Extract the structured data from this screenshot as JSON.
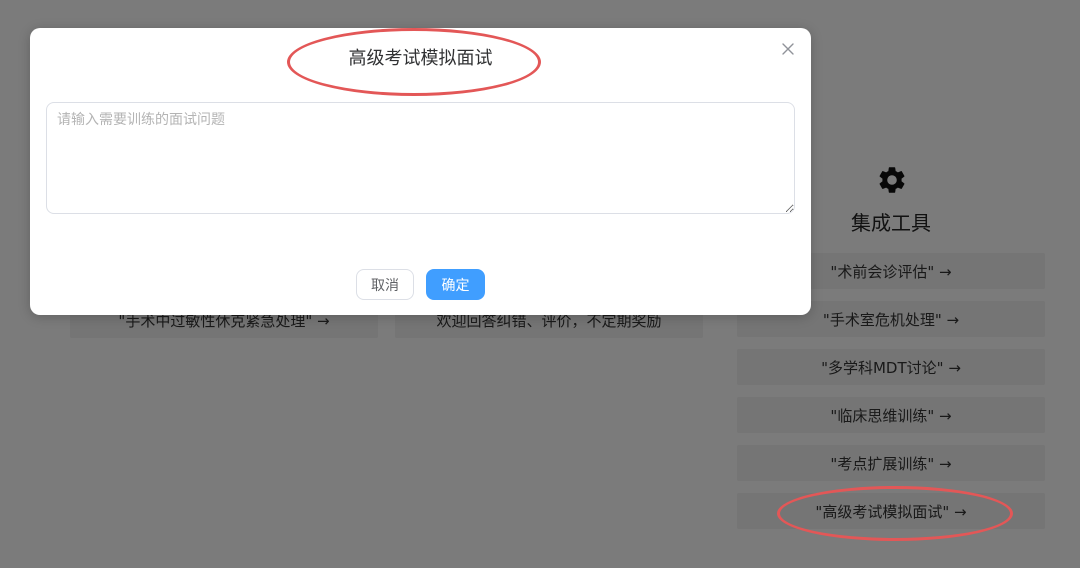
{
  "background": {
    "tools_title": "集成工具",
    "tools_icon": "gear-icon",
    "tools": [
      "\"术前会诊评估\" →",
      "\"手术室危机处理\" →",
      "\"多学科MDT讨论\" →",
      "\"临床思维训练\" →",
      "\"考点扩展训练\" →",
      "\"高级考试模拟面试\" →"
    ],
    "left_partial_1": "\"手术中过敏性休克紧急处理\" →",
    "left_partial_2": "欢迎回答纠错、评价，不定期奖励"
  },
  "dialog": {
    "title": "高级考试模拟面试",
    "close_icon": "close-icon",
    "input_placeholder": "请输入需要训练的面试问题",
    "input_value": "",
    "cancel_label": "取消",
    "confirm_label": "确定"
  },
  "colors": {
    "primary": "#409eff",
    "annotation": "#e35757",
    "overlay": "rgba(0,0,0,0.5)"
  }
}
